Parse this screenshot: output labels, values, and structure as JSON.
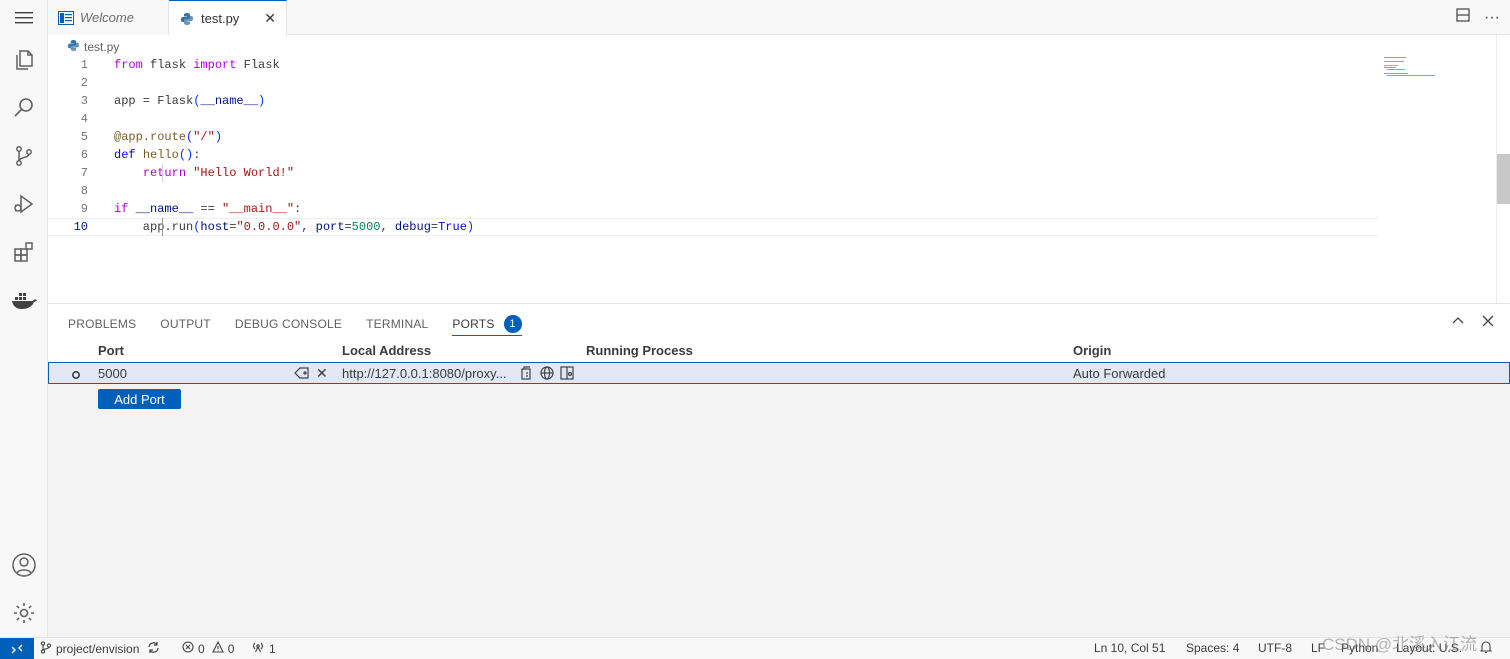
{
  "tabs": [
    {
      "label": "Welcome",
      "icon": "vscode-welcome-icon"
    },
    {
      "label": "test.py",
      "icon": "python-icon"
    }
  ],
  "breadcrumb": {
    "file": "test.py"
  },
  "editor": {
    "line_numbers": [
      "1",
      "2",
      "3",
      "4",
      "5",
      "6",
      "7",
      "8",
      "9",
      "10"
    ],
    "lines": [
      "from flask import Flask",
      "",
      "app = Flask(__name__)",
      "",
      "@app.route(\"/\")",
      "def hello():",
      "    return \"Hello World!\"",
      "",
      "if __name__ == \"__main__\":",
      "    app.run(host=\"0.0.0.0\", port=5000, debug=True)"
    ]
  },
  "panel": {
    "tabs": [
      "PROBLEMS",
      "OUTPUT",
      "DEBUG CONSOLE",
      "TERMINAL",
      "PORTS"
    ],
    "ports_badge": "1",
    "columns": [
      "Port",
      "Local Address",
      "Running Process",
      "Origin"
    ],
    "row": {
      "port": "5000",
      "local_address": "http://127.0.0.1:8080/proxy...",
      "running_process": "",
      "origin": "Auto Forwarded"
    },
    "add_port_label": "Add Port"
  },
  "statusbar": {
    "branch": "project/envision",
    "errors": "0",
    "warnings": "0",
    "ports": "1",
    "position": "Ln 10, Col 51",
    "spaces": "Spaces: 4",
    "encoding": "UTF-8",
    "eol": "LF",
    "language": "Python",
    "layout": "Layout: U.S.",
    "watermark": "CSDN @北溪入江流"
  },
  "colors": {
    "accent": "#005fb8",
    "keyword": "#af00db",
    "string": "#a31515",
    "number": "#098658"
  }
}
